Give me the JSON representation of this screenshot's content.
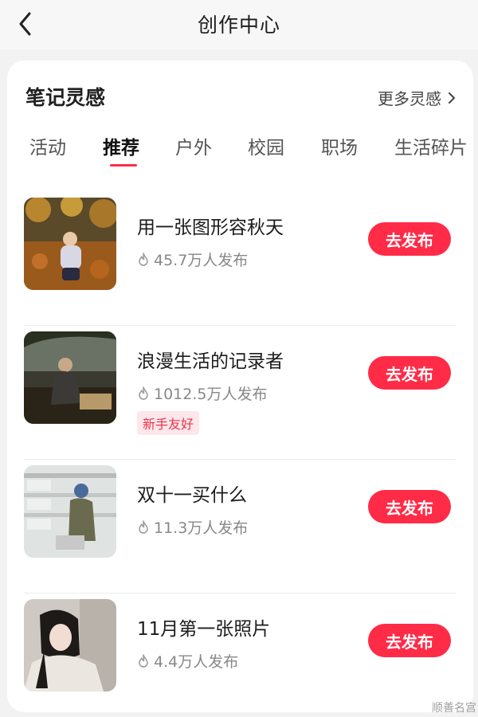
{
  "header": {
    "title": "创作中心",
    "back_icon": "chevron-left-icon"
  },
  "section": {
    "title": "笔记灵感",
    "more_label": "更多灵感",
    "more_icon": "chevron-right-icon"
  },
  "tabs": [
    {
      "label": "活动",
      "active": false
    },
    {
      "label": "推荐",
      "active": true
    },
    {
      "label": "户外",
      "active": false
    },
    {
      "label": "校园",
      "active": false
    },
    {
      "label": "职场",
      "active": false
    },
    {
      "label": "生活碎片",
      "active": false
    }
  ],
  "items": [
    {
      "title": "用一张图形容秋天",
      "count": "45.7万人发布",
      "badge": "",
      "button": "去发布"
    },
    {
      "title": "浪漫生活的记录者",
      "count": "1012.5万人发布",
      "badge": "新手友好",
      "button": "去发布"
    },
    {
      "title": "双十一买什么",
      "count": "11.3万人发布",
      "badge": "",
      "button": "去发布"
    },
    {
      "title": "11月第一张照片",
      "count": "4.4万人发布",
      "badge": "",
      "button": "去发布"
    }
  ],
  "colors": {
    "accent": "#ff2b47",
    "background": "#f2f2f2",
    "card": "#ffffff"
  },
  "watermark": "顺善名宫"
}
